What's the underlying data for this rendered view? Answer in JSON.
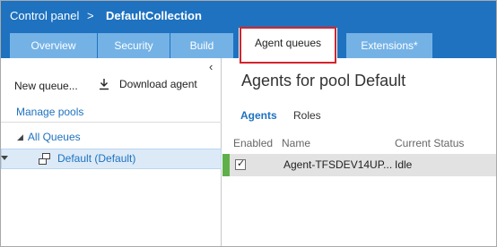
{
  "breadcrumb": {
    "control_panel": "Control panel",
    "separator": ">",
    "collection": "DefaultCollection"
  },
  "tabs": [
    {
      "label": "Overview",
      "active": false
    },
    {
      "label": "Security",
      "active": false
    },
    {
      "label": "Build",
      "active": false
    },
    {
      "label": "Agent queues",
      "active": true
    },
    {
      "label": "Extensions*",
      "active": false
    }
  ],
  "left_pane": {
    "collapse_icon": "chevron-left-icon",
    "new_queue_label": "New queue...",
    "download_agent_label": "Download agent",
    "download_icon": "download-icon",
    "manage_pools_label": "Manage pools",
    "tree": {
      "root_label": "All Queues",
      "selected_item": "Default (Default)",
      "item_icon": "queue-icon"
    }
  },
  "main": {
    "title": "Agents for pool Default",
    "subtabs": [
      {
        "label": "Agents",
        "active": true
      },
      {
        "label": "Roles",
        "active": false
      }
    ],
    "columns": [
      "Enabled",
      "Name",
      "Current Status"
    ],
    "agents": [
      {
        "enabled": true,
        "name": "Agent-TFSDEV14UP...",
        "status": "Idle"
      }
    ]
  },
  "colors": {
    "header_blue": "#1e72c0",
    "tab_light_blue": "#74b2e6",
    "highlight_red": "#d4242b",
    "online_green": "#5fb04a",
    "selection_bg": "#dceaf7"
  }
}
